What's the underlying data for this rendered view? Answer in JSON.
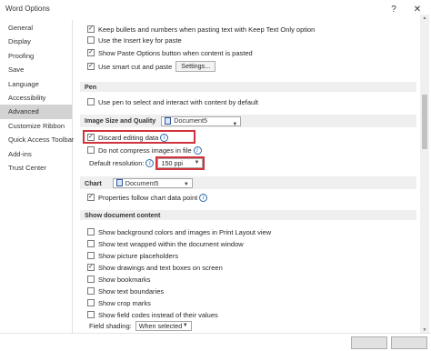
{
  "window": {
    "title": "Word Options",
    "help": "?",
    "close": "✕"
  },
  "sidebar": {
    "items": [
      {
        "label": "General"
      },
      {
        "label": "Display"
      },
      {
        "label": "Proofing"
      },
      {
        "label": "Save"
      },
      {
        "label": "Language"
      },
      {
        "label": "Accessibility"
      },
      {
        "label": "Advanced"
      },
      {
        "label": "Customize Ribbon"
      },
      {
        "label": "Quick Access Toolbar"
      },
      {
        "label": "Add-ins"
      },
      {
        "label": "Trust Center"
      }
    ],
    "active": "Advanced"
  },
  "cut_copy_paste": {
    "keep_bullets": "Keep bullets and numbers when pasting text with Keep Text Only option",
    "use_insert_key": "Use the Insert key for paste",
    "show_paste_options": "Show Paste Options button when content is pasted",
    "smart_cut": "Use smart cut and paste",
    "settings_button": "Settings..."
  },
  "pen": {
    "header": "Pen",
    "use_pen": "Use pen to select and interact with content by default"
  },
  "image_size": {
    "header": "Image Size and Quality",
    "document": "Document5",
    "discard_editing": "Discard editing data",
    "no_compress": "Do not compress images in file",
    "default_resolution_label": "Default resolution:",
    "default_resolution_value": "150 ppi"
  },
  "chart": {
    "header": "Chart",
    "document": "Document5",
    "properties_follow": "Properties follow chart data point"
  },
  "show_document_content": {
    "header": "Show document content",
    "items": [
      "Show background colors and images in Print Layout view",
      "Show text wrapped within the document window",
      "Show picture placeholders",
      "Show drawings and text boxes on screen",
      "Show bookmarks",
      "Show text boundaries",
      "Show crop marks",
      "Show field codes instead of their values"
    ],
    "checked": [
      false,
      false,
      false,
      true,
      false,
      false,
      false,
      false
    ],
    "field_shading_label": "Field shading:",
    "field_shading_value": "When selected"
  }
}
